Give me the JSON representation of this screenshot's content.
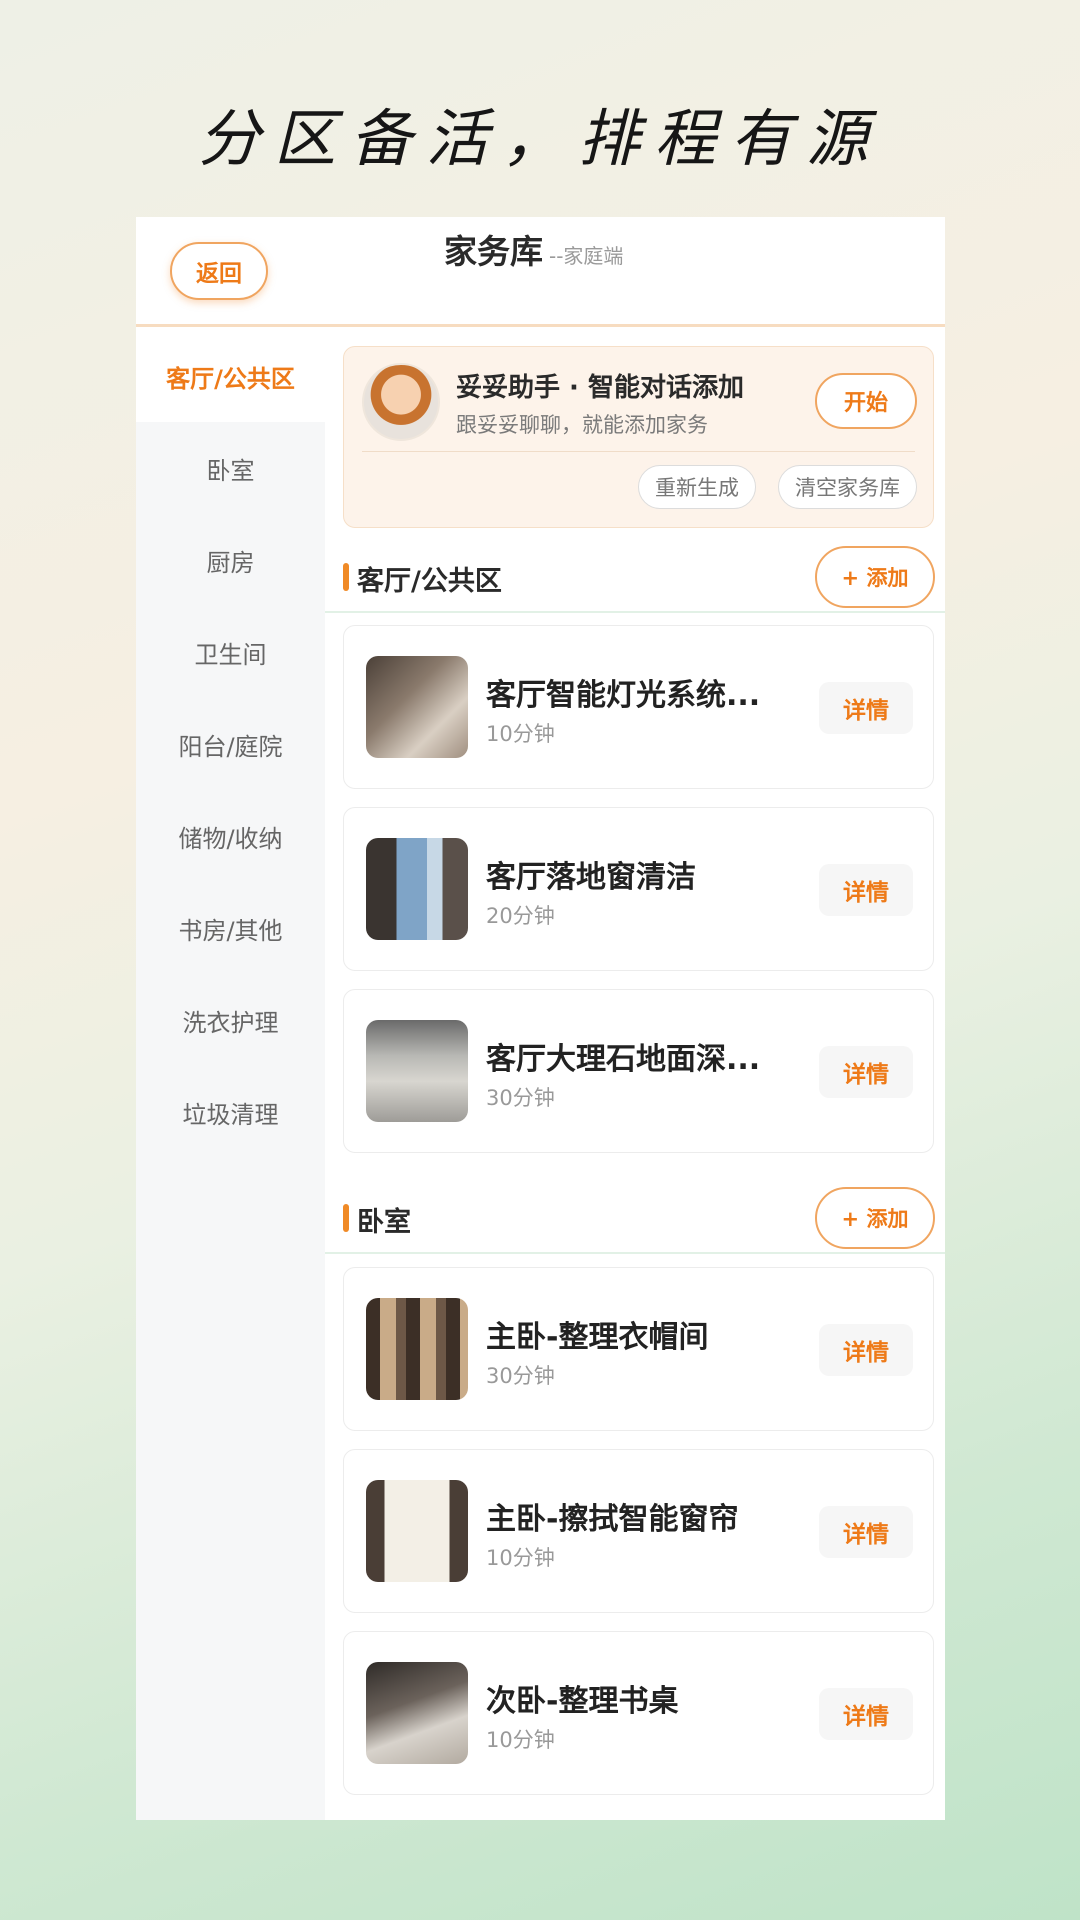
{
  "tagline": "分区备活，排程有源",
  "header": {
    "back_label": "返回",
    "title": "家务库",
    "subtitle": "--家庭端"
  },
  "sidebar": {
    "items": [
      {
        "label": "客厅/公共区"
      },
      {
        "label": "卧室"
      },
      {
        "label": "厨房"
      },
      {
        "label": "卫生间"
      },
      {
        "label": "阳台/庭院"
      },
      {
        "label": "储物/收纳"
      },
      {
        "label": "书房/其他"
      },
      {
        "label": "洗衣护理"
      },
      {
        "label": "垃圾清理"
      }
    ],
    "active_index": 0
  },
  "assistant": {
    "title": "妥妥助手 · 智能对话添加",
    "subtitle": "跟妥妥聊聊，就能添加家务",
    "start_label": "开始",
    "regenerate_label": "重新生成",
    "clear_label": "清空家务库"
  },
  "sections": [
    {
      "title": "客厅/公共区",
      "add_label": "+ 添加",
      "items": [
        {
          "title": "客厅智能灯光系统...",
          "duration": "10分钟",
          "detail_label": "详情"
        },
        {
          "title": "客厅落地窗清洁",
          "duration": "20分钟",
          "detail_label": "详情"
        },
        {
          "title": "客厅大理石地面深...",
          "duration": "30分钟",
          "detail_label": "详情"
        }
      ]
    },
    {
      "title": "卧室",
      "add_label": "+ 添加",
      "items": [
        {
          "title": "主卧-整理衣帽间",
          "duration": "30分钟",
          "detail_label": "详情"
        },
        {
          "title": "主卧-擦拭智能窗帘",
          "duration": "10分钟",
          "detail_label": "详情"
        },
        {
          "title": "次卧-整理书桌",
          "duration": "10分钟",
          "detail_label": "详情"
        }
      ]
    }
  ],
  "colors": {
    "accent": "#ee7a18",
    "accent_border": "#f0a560",
    "assistant_bg": "#fdf3ea"
  }
}
